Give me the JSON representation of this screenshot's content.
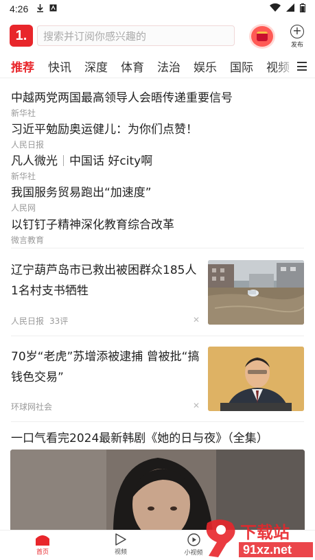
{
  "status_bar": {
    "time": "4:26"
  },
  "header": {
    "logo_text": "1.",
    "search_placeholder": "搜索并订阅你感兴趣的",
    "publish_label": "发布"
  },
  "tabs": [
    {
      "label": "推荐",
      "active": true
    },
    {
      "label": "快讯"
    },
    {
      "label": "深度"
    },
    {
      "label": "体育"
    },
    {
      "label": "法治"
    },
    {
      "label": "娱乐"
    },
    {
      "label": "国际"
    },
    {
      "label": "视频"
    }
  ],
  "headlines": [
    {
      "title": "中越两党两国最高领导人会晤传递重要信号",
      "source": "新华社"
    },
    {
      "title": "习近平勉励奥运健儿：为你们点赞！",
      "source": "人民日报"
    },
    {
      "title_a": "凡人微光",
      "title_b": "中国话 好city啊",
      "source": "新华社"
    },
    {
      "title": "我国服务贸易跑出“加速度”",
      "source": "人民网"
    },
    {
      "title": "以钉钉子精神深化教育综合改革",
      "source": "微言教育"
    }
  ],
  "news": [
    {
      "title": "辽宁葫芦岛市已救出被困群众185人 1名村支书牺牲",
      "source": "人民日报",
      "comments": "33评"
    },
    {
      "title": "70岁“老虎”苏增添被逮捕 曾被批“搞钱色交易”",
      "source": "环球网社会"
    }
  ],
  "video_item": {
    "title": "一口气看完2024最新韩剧《她的日与夜》（全集）"
  },
  "bottom_nav": [
    {
      "label": "首页",
      "active": true
    },
    {
      "label": "视频"
    },
    {
      "label": "小视频"
    }
  ],
  "watermark": {
    "brand": "下载站",
    "domain": "91xz.net",
    "digit": "9"
  },
  "colors": {
    "accent": "#e8262b",
    "text": "#222222",
    "meta": "#999999"
  }
}
